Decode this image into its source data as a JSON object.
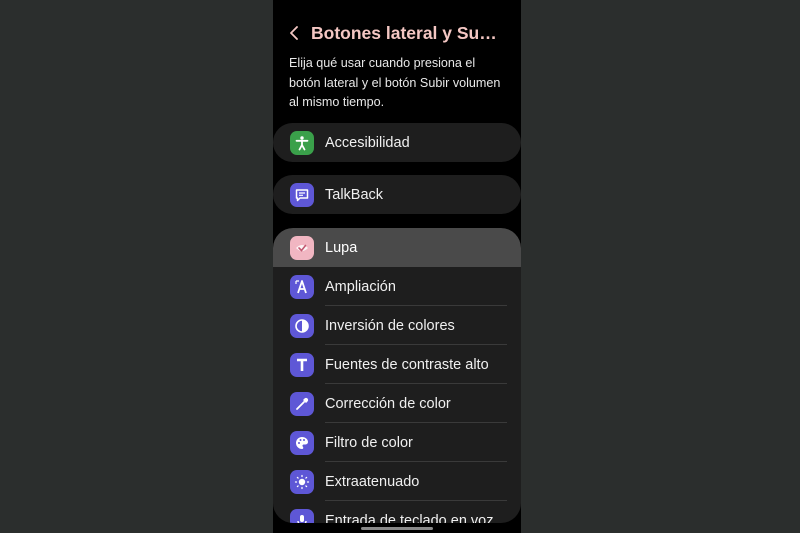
{
  "header": {
    "title": "Botones lateral y Subir...",
    "back_icon": "chevron-left-icon"
  },
  "description": "Elija qué usar cuando presiona el botón lateral y el botón Subir volumen al mismo tiempo.",
  "items": [
    {
      "label": "Accesibilidad",
      "icon": "accessibility-icon",
      "color": "#3aa04a"
    },
    {
      "label": "TalkBack",
      "icon": "talkback-icon",
      "color": "#5e57d6"
    },
    {
      "label": "Lupa",
      "icon": "magnifier-icon",
      "color": "#f1b6c2",
      "highlighted": true
    },
    {
      "label": "Ampliación",
      "icon": "magnification-icon",
      "color": "#5e57d6"
    },
    {
      "label": "Inversión de colores",
      "icon": "color-inversion-icon",
      "color": "#5e57d6"
    },
    {
      "label": "Fuentes de contraste alto",
      "icon": "high-contrast-font-icon",
      "color": "#5e57d6"
    },
    {
      "label": "Corrección de color",
      "icon": "color-correction-icon",
      "color": "#5e57d6"
    },
    {
      "label": "Filtro de color",
      "icon": "color-filter-icon",
      "color": "#5e57d6"
    },
    {
      "label": "Extraatenuado",
      "icon": "extra-dim-icon",
      "color": "#5e57d6"
    },
    {
      "label": "Entrada de teclado en voz",
      "icon": "voice-keyboard-icon",
      "color": "#5e57d6"
    }
  ]
}
